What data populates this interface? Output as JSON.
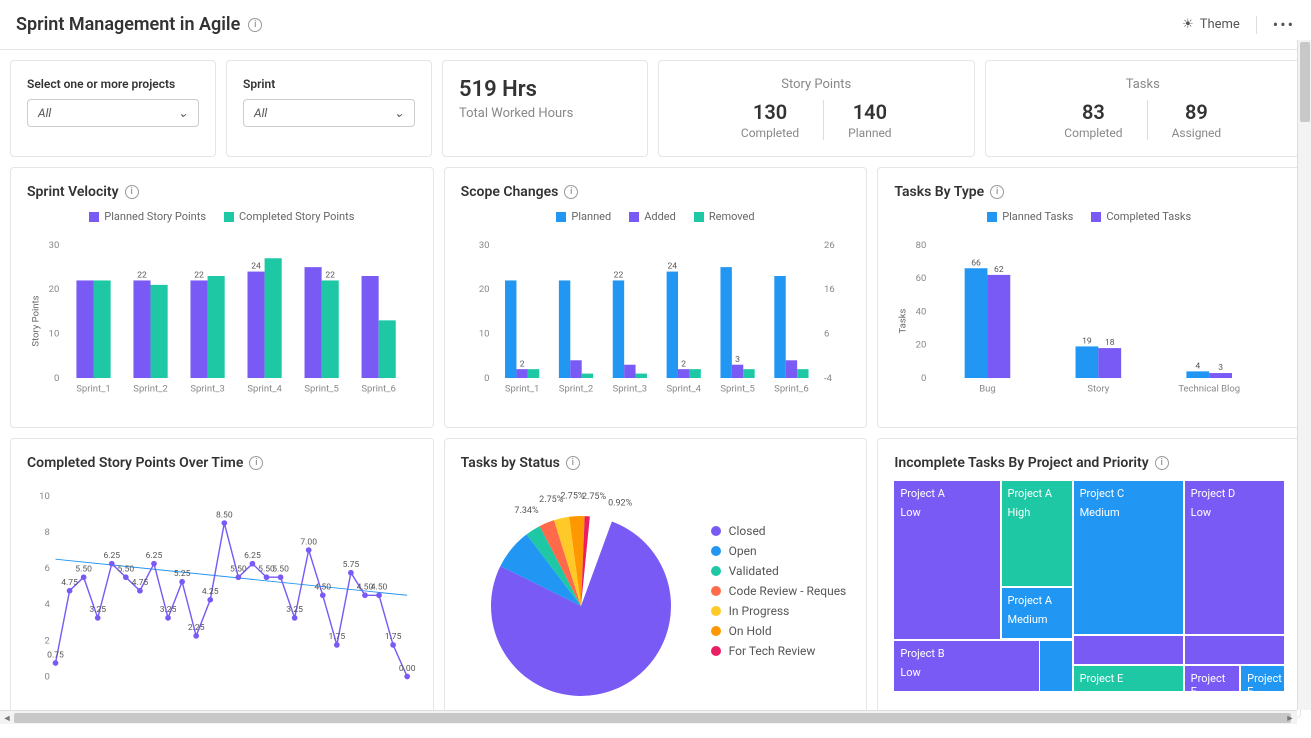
{
  "header": {
    "title": "Sprint Management in Agile",
    "theme_label": "Theme"
  },
  "filters": {
    "project_label": "Select one or more projects",
    "project_value": "All",
    "sprint_label": "Sprint",
    "sprint_value": "All"
  },
  "kpi_hours": {
    "value": "519 Hrs",
    "sub": "Total Worked Hours"
  },
  "kpi_points": {
    "title": "Story Points",
    "completed": "130",
    "completed_label": "Completed",
    "planned": "140",
    "planned_label": "Planned"
  },
  "kpi_tasks": {
    "title": "Tasks",
    "completed": "83",
    "completed_label": "Completed",
    "assigned": "89",
    "assigned_label": "Assigned"
  },
  "velocity": {
    "title": "Sprint Velocity",
    "legend_planned": "Planned Story Points",
    "legend_completed": "Completed Story Points",
    "ylabel": "Story Points"
  },
  "scope": {
    "title": "Scope Changes",
    "legend_planned": "Planned",
    "legend_added": "Added",
    "legend_removed": "Removed"
  },
  "tasks_type": {
    "title": "Tasks By Type",
    "legend_planned": "Planned Tasks",
    "legend_completed": "Completed Tasks",
    "ylabel": "Tasks"
  },
  "completed_time": {
    "title": "Completed Story Points Over Time"
  },
  "tasks_status": {
    "title": "Tasks by Status",
    "legend": [
      "Closed",
      "Open",
      "Validated",
      "Code Review - Reques",
      "In Progress",
      "On Hold",
      "For Tech Review"
    ]
  },
  "incomplete": {
    "title": "Incomplete Tasks By Project and Priority"
  },
  "treemap_labels": {
    "pa_low": "Project A",
    "pa_low2": "Low",
    "pa_high": "Project A",
    "pa_high2": "High",
    "pa_med": "Project A",
    "pa_med2": "Medium",
    "pb_low": "Project B",
    "pb_low2": "Low",
    "pc_med": "Project C",
    "pc_med2": "Medium",
    "pd_low": "Project D",
    "pd_low2": "Low",
    "pe1": "Project E",
    "pe2": "Project E",
    "pe3": "Project E"
  },
  "chart_data": [
    {
      "id": "sprint_velocity",
      "type": "bar",
      "categories": [
        "Sprint_1",
        "Sprint_2",
        "Sprint_3",
        "Sprint_4",
        "Sprint_5",
        "Sprint_6"
      ],
      "series": [
        {
          "name": "Planned Story Points",
          "values": [
            22,
            22,
            22,
            24,
            25,
            23
          ],
          "labels": [
            null,
            "22",
            "22",
            "24",
            null,
            null
          ]
        },
        {
          "name": "Completed Story Points",
          "values": [
            22,
            21,
            23,
            27,
            22,
            13
          ],
          "labels": [
            null,
            null,
            null,
            null,
            "22",
            null
          ]
        }
      ],
      "ylabel": "Story Points",
      "ylim": [
        0,
        30
      ]
    },
    {
      "id": "scope_changes",
      "type": "bar",
      "categories": [
        "Sprint_1",
        "Sprint_2",
        "Sprint_3",
        "Sprint_4",
        "Sprint_5",
        "Sprint_6"
      ],
      "series": [
        {
          "name": "Planned",
          "values": [
            22,
            22,
            22,
            24,
            25,
            23
          ],
          "labels": [
            null,
            null,
            "22",
            "24",
            null,
            null
          ]
        },
        {
          "name": "Added",
          "values": [
            2,
            4,
            3,
            2,
            3,
            4
          ],
          "labels": [
            "2",
            null,
            null,
            "2",
            "3",
            null
          ]
        },
        {
          "name": "Removed",
          "values": [
            2,
            1,
            1,
            2,
            2,
            2
          ]
        }
      ],
      "y2_ticks": [
        -4,
        6,
        16,
        26
      ],
      "ylim": [
        0,
        30
      ]
    },
    {
      "id": "tasks_by_type",
      "type": "bar",
      "categories": [
        "Bug",
        "Story",
        "Technical Blog"
      ],
      "series": [
        {
          "name": "Planned Tasks",
          "values": [
            66,
            19,
            4
          ]
        },
        {
          "name": "Completed Tasks",
          "values": [
            62,
            18,
            3
          ]
        }
      ],
      "ylabel": "Tasks",
      "ylim": [
        0,
        80
      ]
    },
    {
      "id": "completed_over_time",
      "type": "line",
      "values": [
        0.75,
        4.75,
        5.5,
        3.25,
        6.25,
        5.5,
        4.75,
        6.25,
        3.25,
        5.25,
        2.25,
        4.25,
        8.5,
        5.5,
        6.25,
        5.5,
        5.5,
        3.25,
        7,
        4.5,
        1.75,
        5.75,
        4.5,
        4.5,
        1.75,
        0
      ],
      "ylim": [
        0,
        10
      ]
    },
    {
      "id": "tasks_by_status",
      "type": "pie",
      "slices": [
        {
          "label": "Closed",
          "value": 76.74,
          "color": "#7a5af5"
        },
        {
          "label": "Open",
          "value": 7.34,
          "color": "#2196f3"
        },
        {
          "label": "Validated",
          "value": 2.75,
          "color": "#1ec8a5"
        },
        {
          "label": "Code Review - Request",
          "value": 2.75,
          "color": "#ff6b4a"
        },
        {
          "label": "In Progress",
          "value": 2.75,
          "color": "#ffca28"
        },
        {
          "label": "On Hold",
          "value": 2.75,
          "color": "#ff9800"
        },
        {
          "label": "For Tech Review",
          "value": 0.92,
          "color": "#e91e63"
        }
      ],
      "visible_labels": [
        "7.34%",
        "2.75%",
        "2.75%",
        "2.75%",
        "0.92%"
      ]
    },
    {
      "id": "incomplete_treemap",
      "type": "treemap",
      "cells": [
        {
          "project": "Project A",
          "priority": "Low",
          "color": "#7a5af5"
        },
        {
          "project": "Project A",
          "priority": "High",
          "color": "#1ec8a5"
        },
        {
          "project": "Project A",
          "priority": "Medium",
          "color": "#2196f3"
        },
        {
          "project": "Project B",
          "priority": "Low",
          "color": "#7a5af5"
        },
        {
          "project": "Project C",
          "priority": "Medium",
          "color": "#2196f3"
        },
        {
          "project": "Project D",
          "priority": "Low",
          "color": "#7a5af5"
        },
        {
          "project": "Project E",
          "priority": "",
          "color": "#1ec8a5"
        },
        {
          "project": "Project E",
          "priority": "",
          "color": "#7a5af5"
        },
        {
          "project": "Project E",
          "priority": "",
          "color": "#2196f3"
        }
      ]
    }
  ]
}
